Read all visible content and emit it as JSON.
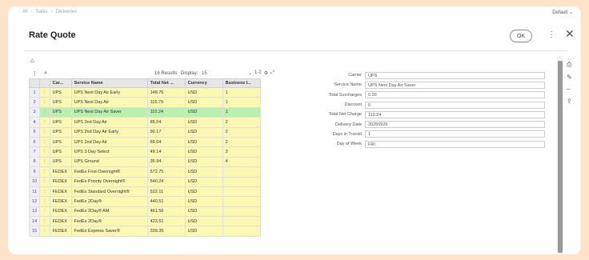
{
  "breadcrumb": [
    "All",
    "Sales",
    "Deliveries"
  ],
  "default_label": "Default",
  "title": "Rate Quote",
  "ok_label": "OK",
  "toolbar": {
    "results": "16 Results",
    "display_label": "Display:",
    "display_value": "15",
    "pager": "1-2"
  },
  "columns": [
    "Car...",
    "Service Name",
    "Total Net ...",
    "Currency",
    "Business I..."
  ],
  "rows": [
    {
      "num": "1",
      "carrier": "UPS",
      "service": "UPS Next Day Air Early",
      "total": "148.76",
      "currency": "USD",
      "business": "1",
      "state": "yel"
    },
    {
      "num": "2",
      "carrier": "UPS",
      "service": "UPS Next Day Air",
      "total": "116.79",
      "currency": "USD",
      "business": "1",
      "state": "yel"
    },
    {
      "num": "3",
      "carrier": "UPS",
      "service": "UPS Next Day Air Saver",
      "total": "110.24",
      "currency": "USD",
      "business": "1",
      "state": "sel"
    },
    {
      "num": "4",
      "carrier": "UPS",
      "service": "UPS 2nd Day Air",
      "total": "85.04",
      "currency": "USD",
      "business": "2",
      "state": "yel"
    },
    {
      "num": "5",
      "carrier": "UPS",
      "service": "UPS 2nd Day Air Early",
      "total": "90.17",
      "currency": "USD",
      "business": "2",
      "state": "yel"
    },
    {
      "num": "6",
      "carrier": "UPS",
      "service": "UPS 2nd Day Air",
      "total": "69.04",
      "currency": "USD",
      "business": "2",
      "state": "yel"
    },
    {
      "num": "7",
      "carrier": "UPS",
      "service": "UPS 3 Day Select",
      "total": "49.14",
      "currency": "USD",
      "business": "3",
      "state": "yel"
    },
    {
      "num": "8",
      "carrier": "UPS",
      "service": "UPS Ground",
      "total": "35.94",
      "currency": "USD",
      "business": "4",
      "state": "yel"
    },
    {
      "num": "9",
      "carrier": "FEDEX",
      "service": "FedEx First Overnight®",
      "total": "572.75",
      "currency": "USD",
      "business": "",
      "state": "yel"
    },
    {
      "num": "10",
      "carrier": "FEDEX",
      "service": "FedEx Priority Overnight®",
      "total": "540.24",
      "currency": "USD",
      "business": "",
      "state": "yel"
    },
    {
      "num": "11",
      "carrier": "FEDEX",
      "service": "FedEx Standard Overnight®",
      "total": "522.11",
      "currency": "USD",
      "business": "",
      "state": "yel"
    },
    {
      "num": "12",
      "carrier": "FEDEX",
      "service": "FedEx 2Day®",
      "total": "440.51",
      "currency": "USD",
      "business": "",
      "state": "yel"
    },
    {
      "num": "13",
      "carrier": "FEDEX",
      "service": "FedEx 2Day® AM",
      "total": "461.56",
      "currency": "USD",
      "business": "",
      "state": "yel"
    },
    {
      "num": "14",
      "carrier": "FEDEX",
      "service": "FedEx 2Day®",
      "total": "423.51",
      "currency": "USD",
      "business": "",
      "state": "yel"
    },
    {
      "num": "15",
      "carrier": "FEDEX",
      "service": "FedEx Express Saver®",
      "total": "339.35",
      "currency": "USD",
      "business": "",
      "state": "yel"
    }
  ],
  "form": [
    {
      "label": "Carrier",
      "value": "UPS"
    },
    {
      "label": "Service Name",
      "value": "UPS Next Day Air Saver"
    },
    {
      "label": "Total Surcharges",
      "value": "0.00"
    },
    {
      "label": "Discount",
      "value": "0"
    },
    {
      "label": "Total Net Charge",
      "value": "110.24"
    },
    {
      "label": "Delivery Date",
      "value": "20250926"
    },
    {
      "label": "Days in Transit",
      "value": "1"
    },
    {
      "label": "Day of Week",
      "value": "FRI"
    }
  ],
  "colors": {
    "row_yellow": "#fbf8b4",
    "row_selected": "#b8f0b0",
    "background": "#fde3c8"
  }
}
